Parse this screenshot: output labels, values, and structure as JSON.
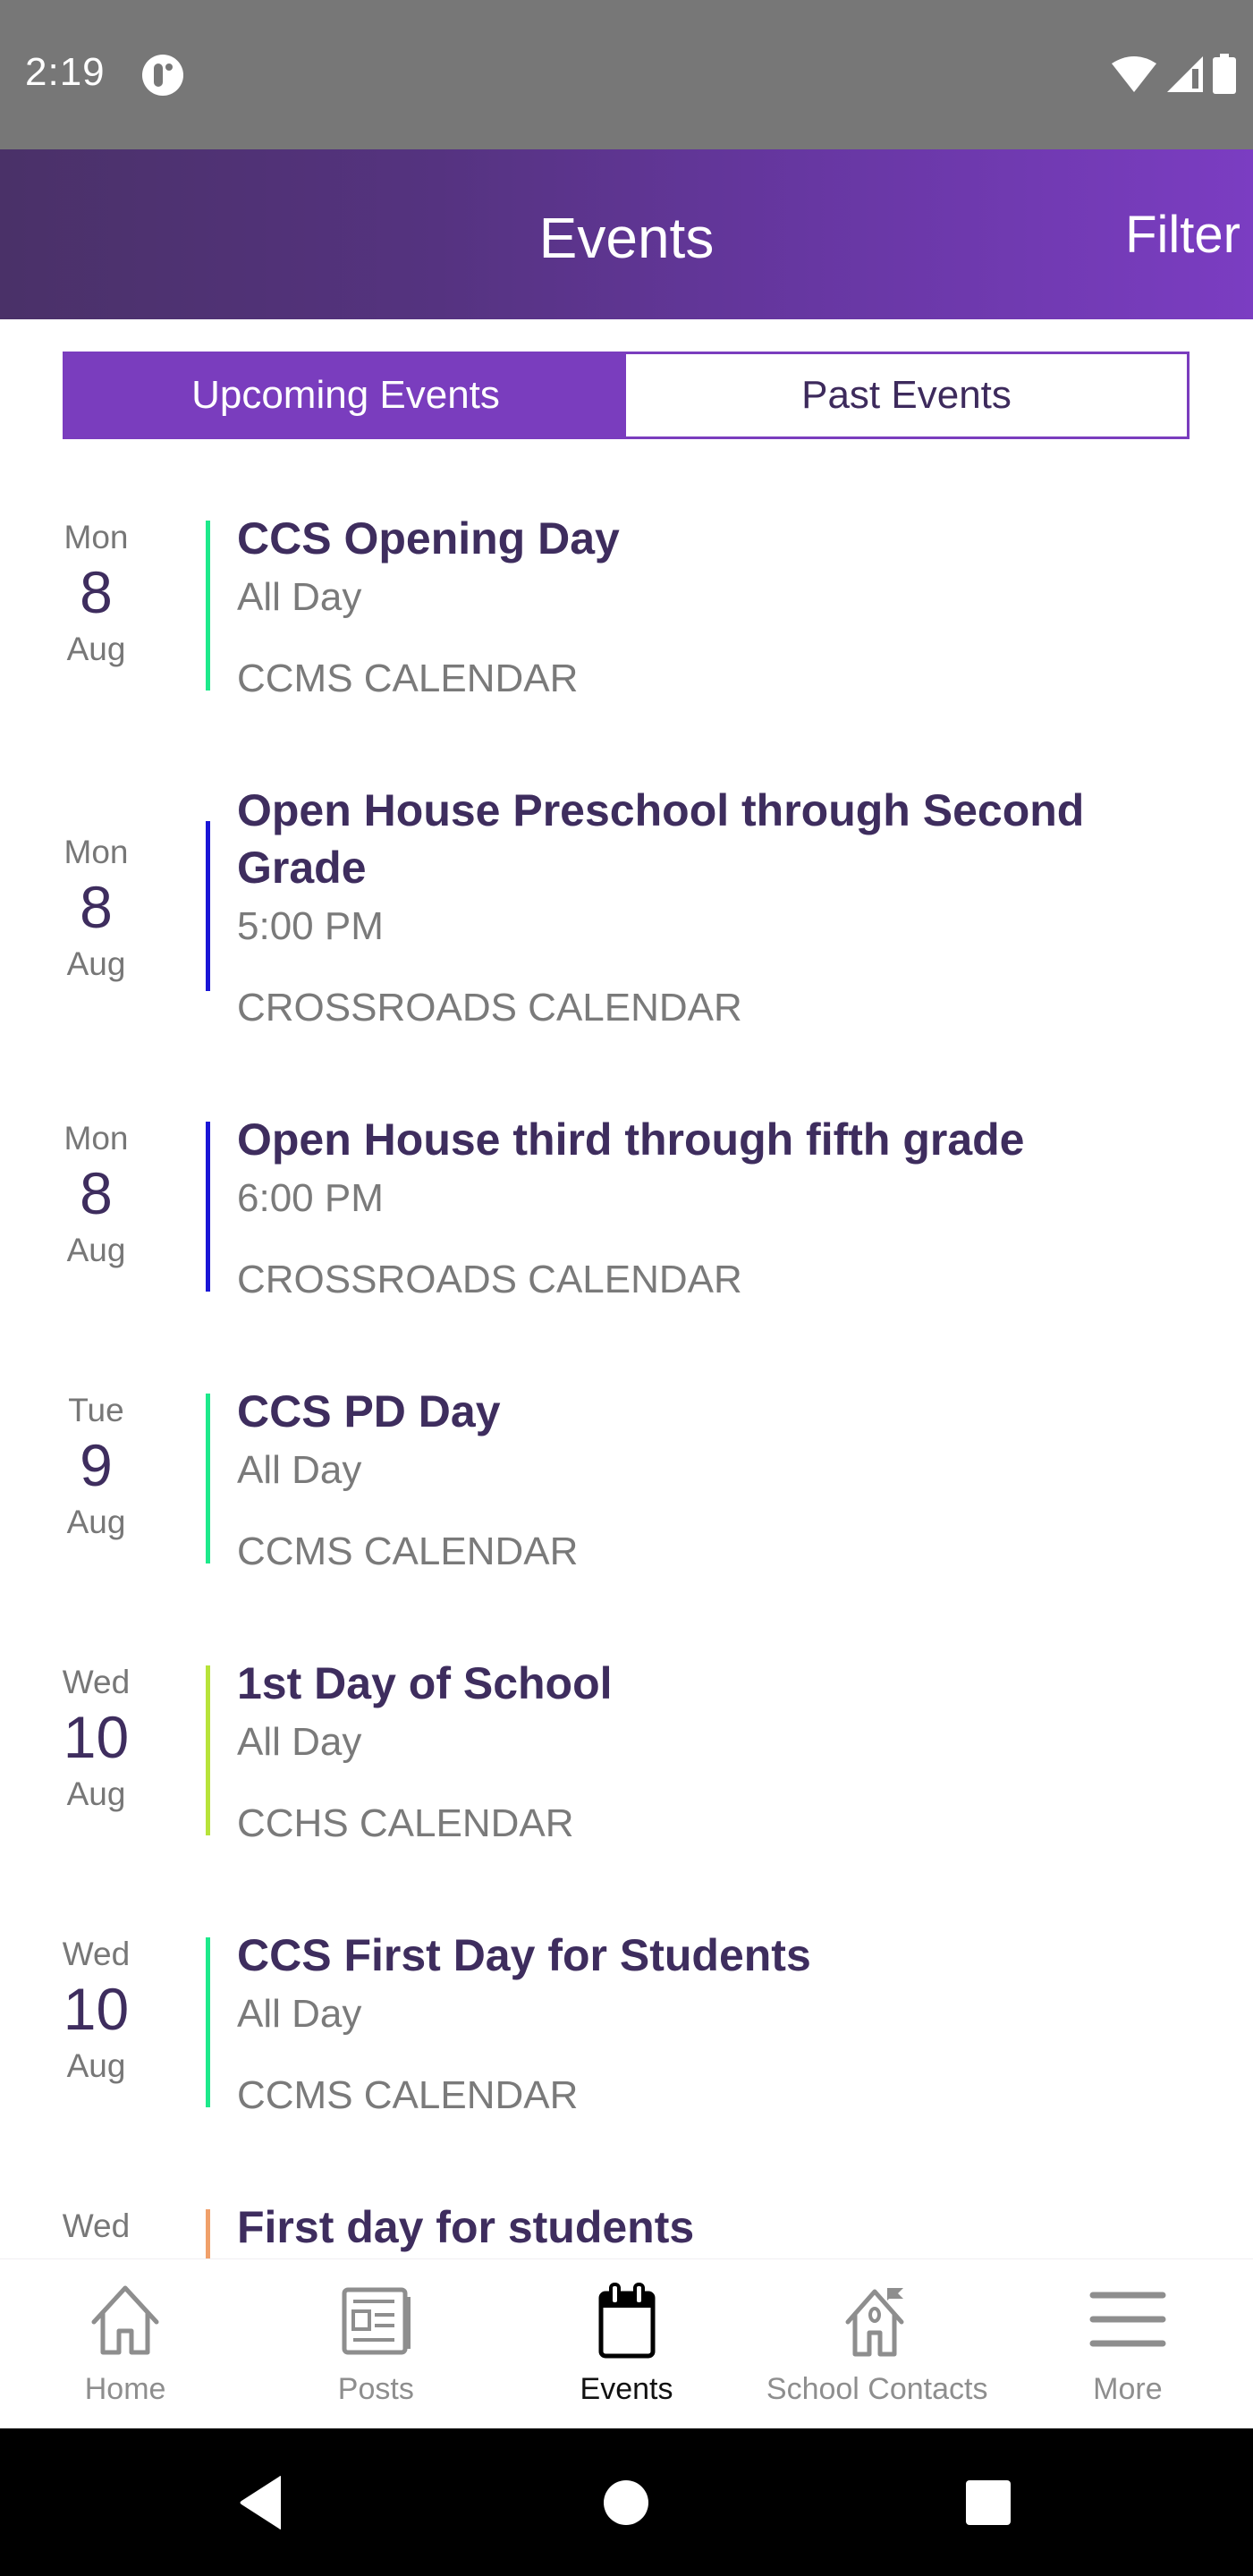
{
  "status_bar": {
    "time": "2:19",
    "icons": [
      "app-notification-icon",
      "wifi-icon",
      "cell-signal-icon",
      "battery-icon"
    ]
  },
  "header": {
    "title": "Events",
    "filter_label": "Filter",
    "gradient_colors": [
      "#4a3168",
      "#7b3dc2"
    ]
  },
  "tabs": [
    {
      "label": "Upcoming Events",
      "active": true
    },
    {
      "label": "Past Events",
      "active": false
    }
  ],
  "accent_color": "#7a3dbe",
  "events": [
    {
      "dow": "Mon",
      "day": "8",
      "month": "Aug",
      "title": "CCS Opening Day",
      "time": "All Day",
      "calendar": "CCMS CALENDAR",
      "color": "#1de98b"
    },
    {
      "dow": "Mon",
      "day": "8",
      "month": "Aug",
      "title": "Open House Preschool through Second Grade",
      "time": "5:00 PM",
      "calendar": "CROSSROADS CALENDAR",
      "color": "#1a16d6"
    },
    {
      "dow": "Mon",
      "day": "8",
      "month": "Aug",
      "title": "Open House third through fifth grade",
      "time": "6:00 PM",
      "calendar": "CROSSROADS CALENDAR",
      "color": "#1a16d6"
    },
    {
      "dow": "Tue",
      "day": "9",
      "month": "Aug",
      "title": "CCS PD Day",
      "time": "All Day",
      "calendar": "CCMS CALENDAR",
      "color": "#1de98b"
    },
    {
      "dow": "Wed",
      "day": "10",
      "month": "Aug",
      "title": "1st Day of School",
      "time": "All Day",
      "calendar": "CCHS CALENDAR",
      "color": "#b7e33a"
    },
    {
      "dow": "Wed",
      "day": "10",
      "month": "Aug",
      "title": "CCS First Day for Students",
      "time": "All Day",
      "calendar": "CCMS CALENDAR",
      "color": "#1de98b"
    },
    {
      "dow": "Wed",
      "day": "",
      "month": "",
      "title": "First day for students",
      "time": "",
      "calendar": "",
      "color": "#f0a06a"
    }
  ],
  "bottom_nav": [
    {
      "label": "Home",
      "icon": "home-icon",
      "active": false
    },
    {
      "label": "Posts",
      "icon": "newspaper-icon",
      "active": false
    },
    {
      "label": "Events",
      "icon": "calendar-icon",
      "active": true
    },
    {
      "label": "School Contacts",
      "icon": "school-icon",
      "active": false
    },
    {
      "label": "More",
      "icon": "menu-icon",
      "active": false
    }
  ],
  "system_nav": [
    "back-icon",
    "home-circle-icon",
    "recents-icon"
  ]
}
